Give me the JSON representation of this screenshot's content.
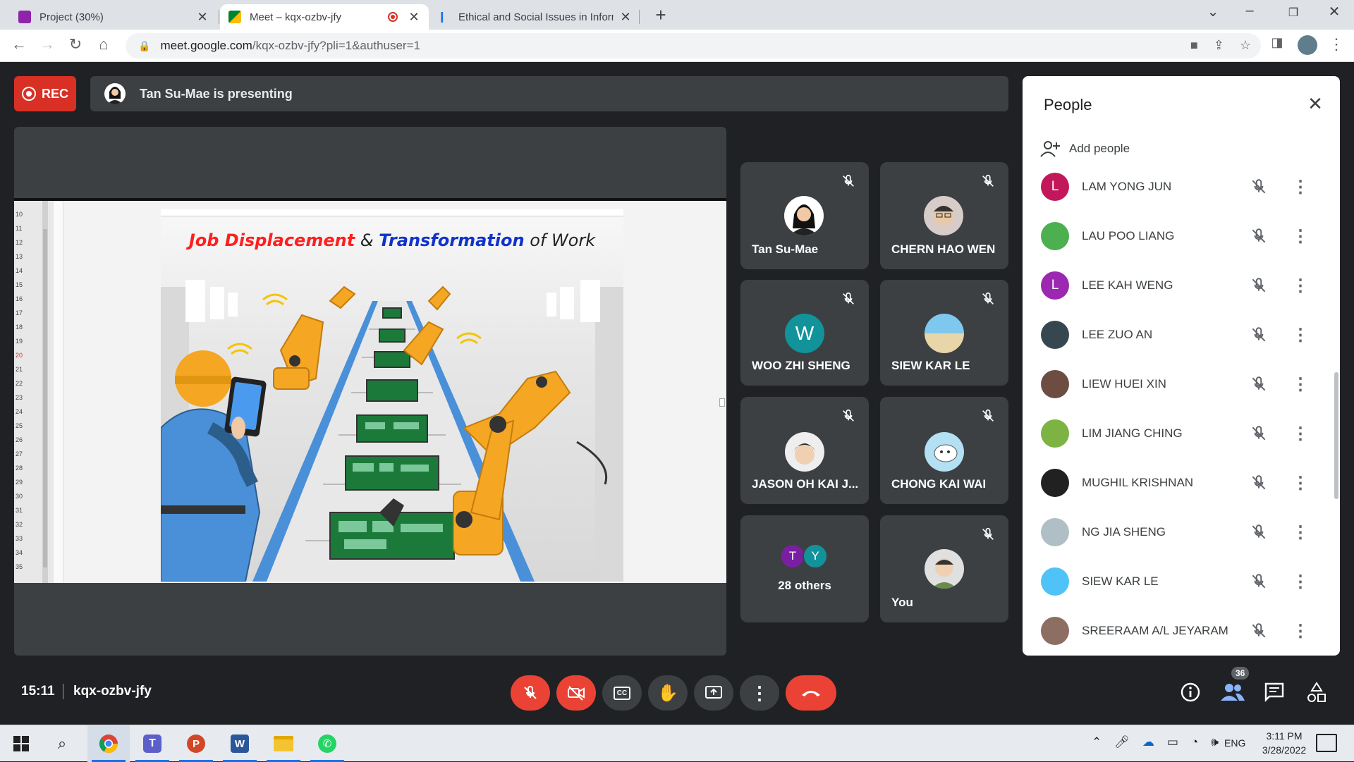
{
  "browser": {
    "tabs": [
      {
        "title": "Project (30%)",
        "active": false
      },
      {
        "title": "Meet – kqx-ozbv-jfy",
        "active": true
      },
      {
        "title": "Ethical and Social Issues in Inform",
        "active": false
      }
    ],
    "url_host": "meet.google.com",
    "url_path": "/kqx-ozbv-jfy?pli=1&authuser=1"
  },
  "meet": {
    "rec_label": "REC",
    "presenting_text": "Tan Su-Mae is presenting",
    "slide": {
      "title_part1": "Job Displacement",
      "title_amp": " & ",
      "title_part2": "Transformation",
      "title_part3": " of Work"
    },
    "tiles": [
      {
        "name": "Tan Su-Mae",
        "muted": true
      },
      {
        "name": "CHERN HAO WEN",
        "muted": true
      },
      {
        "name": "WOO ZHI SHENG",
        "initial": "W",
        "muted": true
      },
      {
        "name": "SIEW KAR LE",
        "muted": true
      },
      {
        "name": "JASON OH KAI J...",
        "muted": true
      },
      {
        "name": "CHONG KAI WAI",
        "muted": true
      },
      {
        "name": "28 others",
        "initials": [
          "T",
          "Y"
        ]
      },
      {
        "name": "You",
        "muted": true
      }
    ],
    "time": "15:11",
    "meeting_code": "kqx-ozbv-jfy",
    "participant_count": "36"
  },
  "people_panel": {
    "title": "People",
    "add_people": "Add people",
    "participants": [
      {
        "name": "LAM YONG JUN",
        "initial": "L",
        "color": "#c2185b"
      },
      {
        "name": "LAU POO LIANG",
        "color": "#4caf50"
      },
      {
        "name": "LEE KAH WENG",
        "initial": "L",
        "color": "#9c27b0"
      },
      {
        "name": "LEE ZUO AN",
        "color": "#37474f"
      },
      {
        "name": "LIEW HUEI XIN",
        "color": "#6d4c41"
      },
      {
        "name": "LIM JIANG CHING",
        "color": "#7cb342"
      },
      {
        "name": "MUGHIL KRISHNAN",
        "color": "#212121"
      },
      {
        "name": "NG JIA SHENG",
        "color": "#b0bec5"
      },
      {
        "name": "SIEW KAR LE",
        "color": "#4fc3f7"
      },
      {
        "name": "SREERAAM A/L JEYARAM",
        "color": "#8d6e63"
      }
    ]
  },
  "taskbar": {
    "language": "ENG",
    "time": "3:11 PM",
    "date": "3/28/2022"
  }
}
